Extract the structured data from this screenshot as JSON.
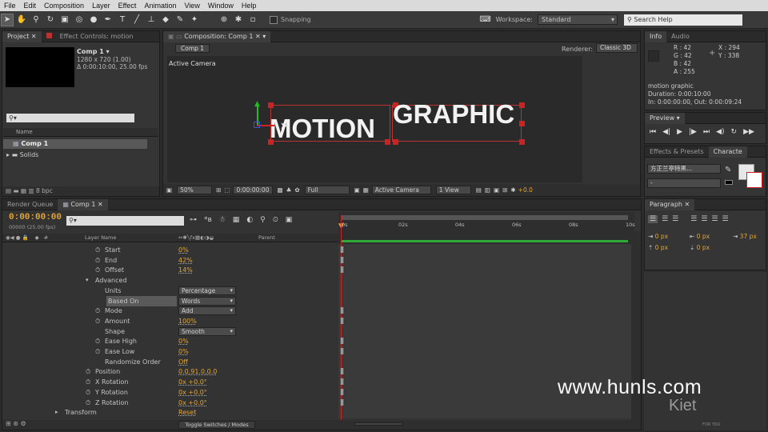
{
  "menu": [
    "File",
    "Edit",
    "Composition",
    "Layer",
    "Effect",
    "Animation",
    "View",
    "Window",
    "Help"
  ],
  "toolbar": {
    "snapping": "Snapping",
    "workspace_label": "Workspace:",
    "workspace_value": "Standard",
    "search_placeholder": "Search Help"
  },
  "project": {
    "tab_project": "Project",
    "tab_effect": "Effect Controls: motion",
    "comp_name": "Comp 1 ▾",
    "comp_size": "1280 x 720 (1.00)",
    "comp_duration": "Δ 0:00:10:00, 25.00 fps",
    "col_name": "Name",
    "items": [
      "Comp 1",
      "Solids"
    ],
    "bpc": "8 bpc"
  },
  "composition": {
    "tab": "Composition: Comp 1",
    "breadcrumb": "Comp 1",
    "renderer_label": "Renderer:",
    "renderer_value": "Classic 3D",
    "camera_label": "Active Camera",
    "text1": "MOTION",
    "text2": "GRAPHIC",
    "zoom": "50%",
    "timecode": "0:00:00:00",
    "resolution": "Full",
    "camera_select": "Active Camera",
    "view_select": "1 View",
    "exposure": "+0.0"
  },
  "info": {
    "tab_info": "Info",
    "tab_audio": "Audio",
    "r": "R : 42",
    "g": "G : 42",
    "b": "B : 42",
    "a": "A : 255",
    "x": "X : 294",
    "y": "Y : 338",
    "layer": "motion graphic",
    "duration": "Duration: 0:00:10:00",
    "inout": "In: 0:00:00:00, Out: 0:00:09:24"
  },
  "preview": {
    "tab": "Preview"
  },
  "effects": {
    "tab1": "Effects & Presets",
    "tab2": "Characte",
    "font": "方正兰亭特黑...",
    "style": "-"
  },
  "paragraph": {
    "tab": "Paragraph",
    "v1": "0 px",
    "v2": "0 px",
    "v3": "37 px",
    "v4": "0 px",
    "v5": "0 px"
  },
  "timeline": {
    "tab_render": "Render Queue",
    "tab_comp": "Comp 1",
    "timecode": "0:00:00:00",
    "frames": "00000 (25.00 fps)",
    "col_layer": "Layer Name",
    "col_parent": "Parent",
    "ruler": [
      "0s",
      "02s",
      "04s",
      "06s",
      "08s",
      "10s"
    ],
    "toggle": "Toggle Switches / Modes",
    "props": [
      {
        "label": "Start",
        "value": "0%",
        "indent": 2,
        "sw": true
      },
      {
        "label": "End",
        "value": "42%",
        "indent": 2,
        "sw": true
      },
      {
        "label": "Offset",
        "value": "14%",
        "indent": 2,
        "sw": true
      },
      {
        "label": "Advanced",
        "value": "",
        "indent": 1,
        "sw": false,
        "tw": true
      },
      {
        "label": "Units",
        "value": "",
        "indent": 2,
        "sw": false,
        "dd": "Percentage"
      },
      {
        "label": "Based On",
        "value": "",
        "indent": 2,
        "sw": false,
        "dd": "Words",
        "hl": true
      },
      {
        "label": "Mode",
        "value": "",
        "indent": 2,
        "sw": true,
        "dd": "Add"
      },
      {
        "label": "Amount",
        "value": "100%",
        "indent": 2,
        "sw": true
      },
      {
        "label": "Shape",
        "value": "",
        "indent": 2,
        "sw": false,
        "dd": "Smooth"
      },
      {
        "label": "Ease High",
        "value": "0%",
        "indent": 2,
        "sw": true
      },
      {
        "label": "Ease Low",
        "value": "0%",
        "indent": 2,
        "sw": true
      },
      {
        "label": "Randomize Order",
        "value": "Off",
        "indent": 2,
        "sw": false
      },
      {
        "label": "Position",
        "value": "0.0,91.0,0.0",
        "indent": 1,
        "sw": true
      },
      {
        "label": "X Rotation",
        "value": "0x +0.0°",
        "indent": 1,
        "sw": true
      },
      {
        "label": "Y Rotation",
        "value": "0x +0.0°",
        "indent": 1,
        "sw": true
      },
      {
        "label": "Z Rotation",
        "value": "0x +0.0°",
        "indent": 1,
        "sw": true
      },
      {
        "label": "Transform",
        "value": "Reset",
        "indent": 0,
        "sw": false,
        "tw": true
      }
    ]
  },
  "watermark": {
    "url": "www.hunls.com",
    "brand": "Kiet",
    "sub": "FOR YOU"
  }
}
